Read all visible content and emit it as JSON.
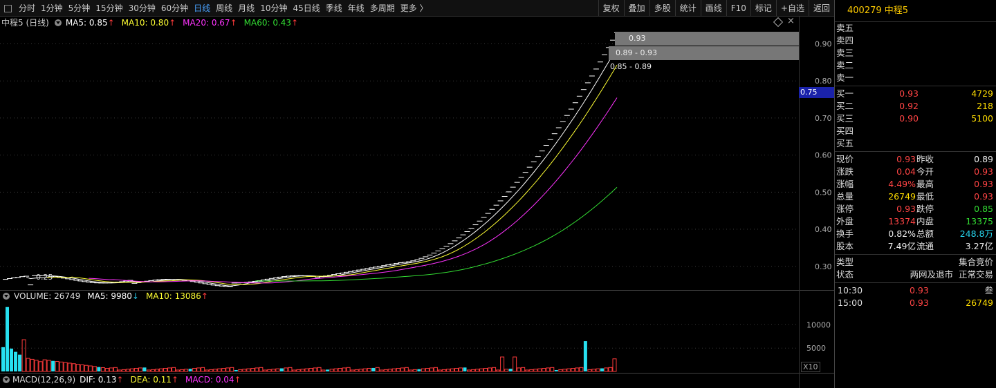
{
  "toolbar": {
    "periods": [
      "分时",
      "1分钟",
      "5分钟",
      "15分钟",
      "30分钟",
      "60分钟",
      "日线",
      "周线",
      "月线",
      "10分钟",
      "45日线",
      "季线",
      "年线",
      "多周期",
      "更多 〉"
    ],
    "active_period": "日线",
    "right_buttons": [
      "复权",
      "叠加",
      "多股",
      "统计",
      "画线",
      "F10",
      "标记",
      "+自选",
      "返回"
    ]
  },
  "price_legend": {
    "name": "中程5 (日线)",
    "ma5": "MA5: 0.85",
    "ma10": "MA10: 0.80",
    "ma20": "MA20: 0.67",
    "ma60": "MA60: 0.43",
    "arrow": "↑",
    "colors": {
      "ma5": "#ffffff",
      "ma10": "#ffff33",
      "ma20": "#ff33ff",
      "ma60": "#33dd33"
    }
  },
  "volume_legend": {
    "label": "VOLUME: 26749",
    "ma5": "MA5: 9980",
    "ma5_arrow": "↓",
    "ma10": "MA10: 13086",
    "ma10_arrow": "↑"
  },
  "macd_legend": {
    "label": "MACD(12,26,9)",
    "dif": "DIF: 0.13",
    "dea": "DEA: 0.11",
    "macd": "MACD: 0.04",
    "arrow": "↑"
  },
  "chart_data": {
    "type": "candlestick",
    "y_axis": {
      "ticks": [
        "0.90",
        "0.80",
        "0.70",
        "0.60",
        "0.50",
        "0.40",
        "0.30"
      ],
      "range": [
        0.24,
        0.94
      ]
    },
    "volume_axis": {
      "ticks": [
        "10000",
        "5000"
      ],
      "unit": "X10"
    },
    "current_price_tag": "0.75",
    "annotations": {
      "low_label": "0.25",
      "top_label": "0.93",
      "gap_label_1": "0.89 - 0.93",
      "gap_label_2": "0.85 - 0.89"
    },
    "low": 0.25,
    "high": 0.93
  },
  "quote": {
    "code": "400279",
    "name": "中程5",
    "asks": [
      {
        "label": "卖五"
      },
      {
        "label": "卖四"
      },
      {
        "label": "卖三"
      },
      {
        "label": "卖二"
      },
      {
        "label": "卖一"
      }
    ],
    "bids": [
      {
        "label": "买一",
        "price": "0.93",
        "vol": "4729"
      },
      {
        "label": "买二",
        "price": "0.92",
        "vol": "218"
      },
      {
        "label": "买三",
        "price": "0.90",
        "vol": "5100"
      },
      {
        "label": "买四",
        "price": "",
        "vol": ""
      },
      {
        "label": "买五",
        "price": "",
        "vol": ""
      }
    ],
    "stats": [
      {
        "l1": "现价",
        "v1": "0.93",
        "c1": "c-red",
        "l2": "昨收",
        "v2": "0.89",
        "c2": "c-wht"
      },
      {
        "l1": "涨跌",
        "v1": "0.04",
        "c1": "c-red",
        "l2": "今开",
        "v2": "0.93",
        "c2": "c-red"
      },
      {
        "l1": "涨幅",
        "v1": "4.49%",
        "c1": "c-red",
        "l2": "最高",
        "v2": "0.93",
        "c2": "c-red"
      },
      {
        "l1": "总量",
        "v1": "26749",
        "c1": "c-yel",
        "l2": "最低",
        "v2": "0.93",
        "c2": "c-red"
      },
      {
        "l1": "涨停",
        "v1": "0.93",
        "c1": "c-red",
        "l2": "跌停",
        "v2": "0.85",
        "c2": "c-grn"
      },
      {
        "l1": "外盘",
        "v1": "13374",
        "c1": "c-red",
        "l2": "内盘",
        "v2": "13375",
        "c2": "c-grn"
      },
      {
        "l1": "换手",
        "v1": "0.82%",
        "c1": "c-wht",
        "l2": "总额",
        "v2": "248.8万",
        "c2": "c-cyn"
      },
      {
        "l1": "股本",
        "v1": "7.49亿",
        "c1": "c-wht",
        "l2": "流通",
        "v2": "3.27亿",
        "c2": "c-wht"
      }
    ],
    "type_row": {
      "label": "类型",
      "value": "集合竞价"
    },
    "status_row": {
      "label": "状态",
      "value_a": "两网及退市",
      "value_b": "正常交易"
    },
    "trades": [
      {
        "time": "10:30",
        "price": "0.93",
        "vol": "叁",
        "vol_color": "#cccccc"
      },
      {
        "time": "15:00",
        "price": "0.93",
        "vol": "26749",
        "vol_color": "#ffdd00"
      }
    ]
  }
}
